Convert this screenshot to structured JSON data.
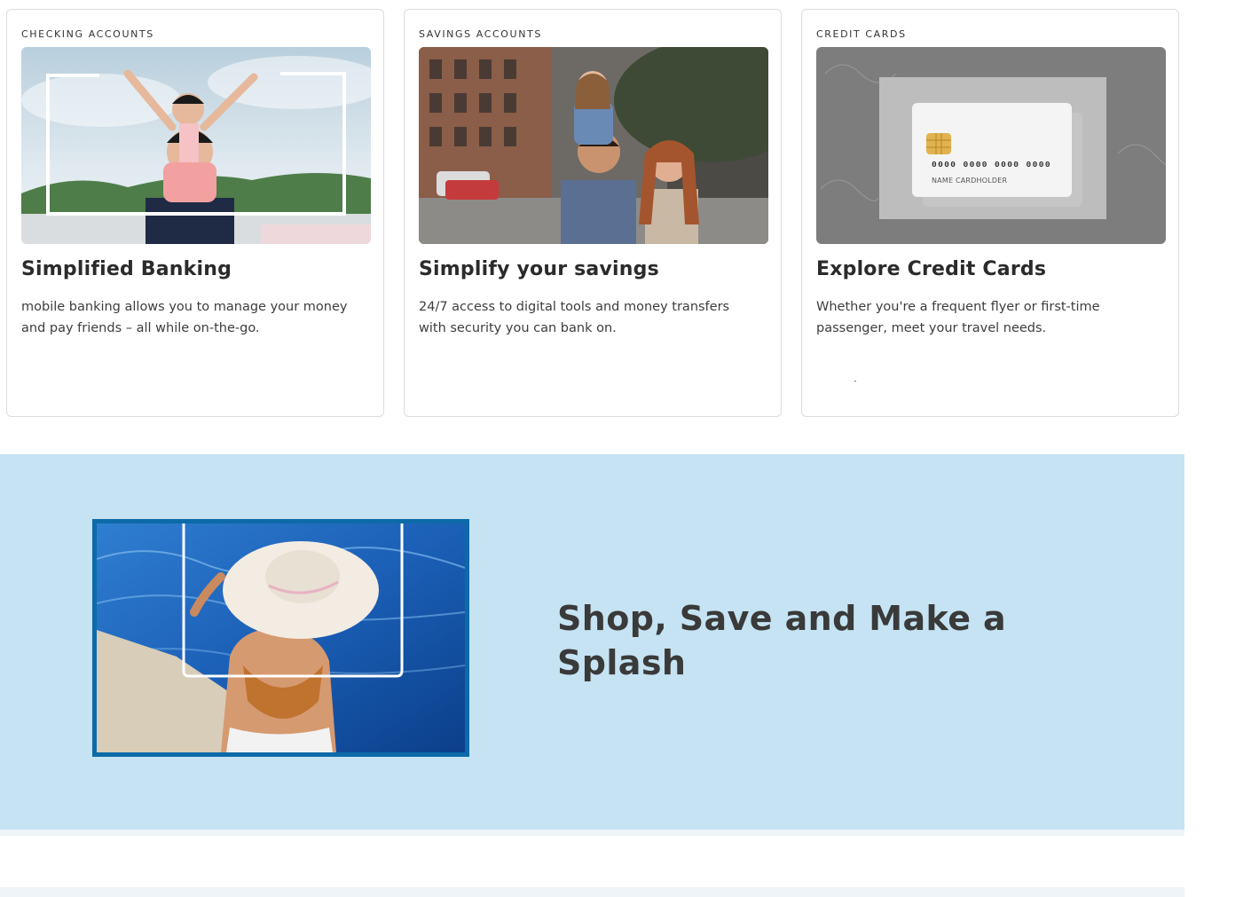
{
  "cards": [
    {
      "eyebrow": "CHECKING ACCOUNTS",
      "title": "Simplified Banking",
      "description": "mobile banking allows you to manage your money and pay friends – all while on-the-go."
    },
    {
      "eyebrow": "SAVINGS ACCOUNTS",
      "title": "Simplify your savings",
      "description": "24/7 access to digital tools and money transfers with security you can bank on."
    },
    {
      "eyebrow": "CREDIT CARDS",
      "title": "Explore  Credit Cards",
      "description": "Whether you're a frequent flyer or first-time passenger, meet your travel needs.",
      "card_number_mask": "0000 0000 0000 0000",
      "card_name": "NAME  CARDHOLDER"
    }
  ],
  "promo": {
    "title": "Shop, Save and Make a Splash"
  },
  "colors": {
    "band": "#c5e3f3",
    "frame": "#0d6aa8",
    "card_border": "#dcdcdc"
  },
  "icons": [
    "chip-icon"
  ]
}
